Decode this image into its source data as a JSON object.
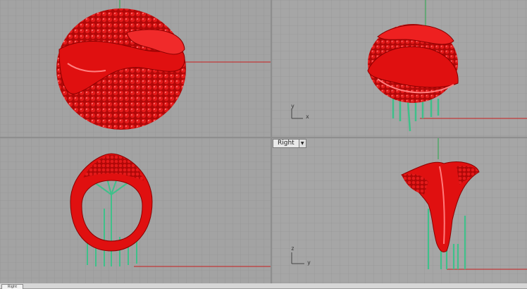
{
  "viewports": {
    "top_left": {
      "label": "",
      "axes": {
        "v": "",
        "h": ""
      }
    },
    "top_right": {
      "label": "",
      "axes": {
        "v": "y",
        "h": "x"
      }
    },
    "bottom_left": {
      "label": "",
      "axes": {
        "v": "",
        "h": ""
      }
    },
    "bottom_right": {
      "label": "Right",
      "axes": {
        "v": "z",
        "h": "y"
      }
    }
  },
  "bottom_tabs": {
    "active_label": "Right"
  },
  "colors": {
    "model": "#e01010",
    "supports": "#3fc08a",
    "grid": "#8c8c8c",
    "grid_major": "#7a7a7a",
    "axis_red": "#c81e1e",
    "axis_green": "#27a84a"
  },
  "icons": {
    "dropdown": "chevron-down-icon"
  }
}
